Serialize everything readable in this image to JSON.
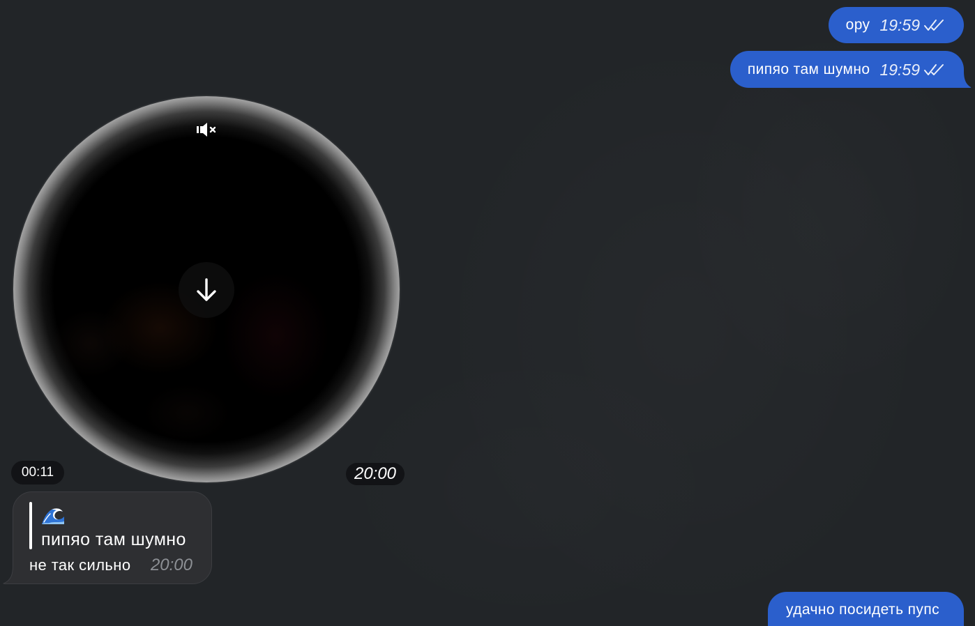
{
  "theme": {
    "chat_background": "#222528",
    "outgoing_bubble": "#2b5fcc",
    "incoming_bubble": "#2e2f32",
    "incoming_border": "#3c3d41",
    "badge_background": "#121316",
    "secondary_text": "#8d9095"
  },
  "chat": {
    "msg_out_1": {
      "text": "ору",
      "time": "19:59",
      "status_icon": "double-check-icon"
    },
    "msg_out_2": {
      "text": "пипяо там шумно",
      "time": "19:59",
      "status_icon": "double-check-icon"
    },
    "video_note": {
      "duration": "00:11",
      "time": "20:00",
      "sound_icon": "muted-speaker-icon",
      "action_icon": "download-arrow-icon"
    },
    "msg_in_1": {
      "reply": {
        "emoji_icon": "water-wave-icon",
        "text": "пипяо там шумно"
      },
      "text": "не так сильно",
      "time": "20:00"
    },
    "msg_out_3": {
      "text": "удачно посидеть пупс"
    }
  }
}
